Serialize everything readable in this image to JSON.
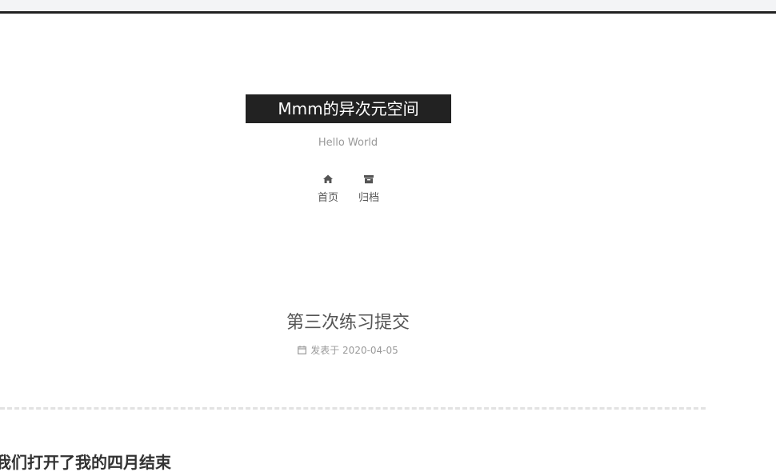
{
  "site": {
    "title": "Mmm的异次元空间",
    "subtitle": "Hello World"
  },
  "menu": [
    {
      "label": "首页",
      "icon": "home-icon"
    },
    {
      "label": "归档",
      "icon": "archive-icon"
    }
  ],
  "post": {
    "title": "第三次练习提交",
    "meta_prefix": "发表于",
    "date": "2020-04-05",
    "meta_icon": "calendar-icon",
    "excerpt": "我们打开了我的四月结束"
  },
  "colors": {
    "brand_bg": "#222222",
    "brand_text": "#ffffff",
    "muted_text": "#999999",
    "body_text": "#555555",
    "divider": "#e2e2e2"
  }
}
